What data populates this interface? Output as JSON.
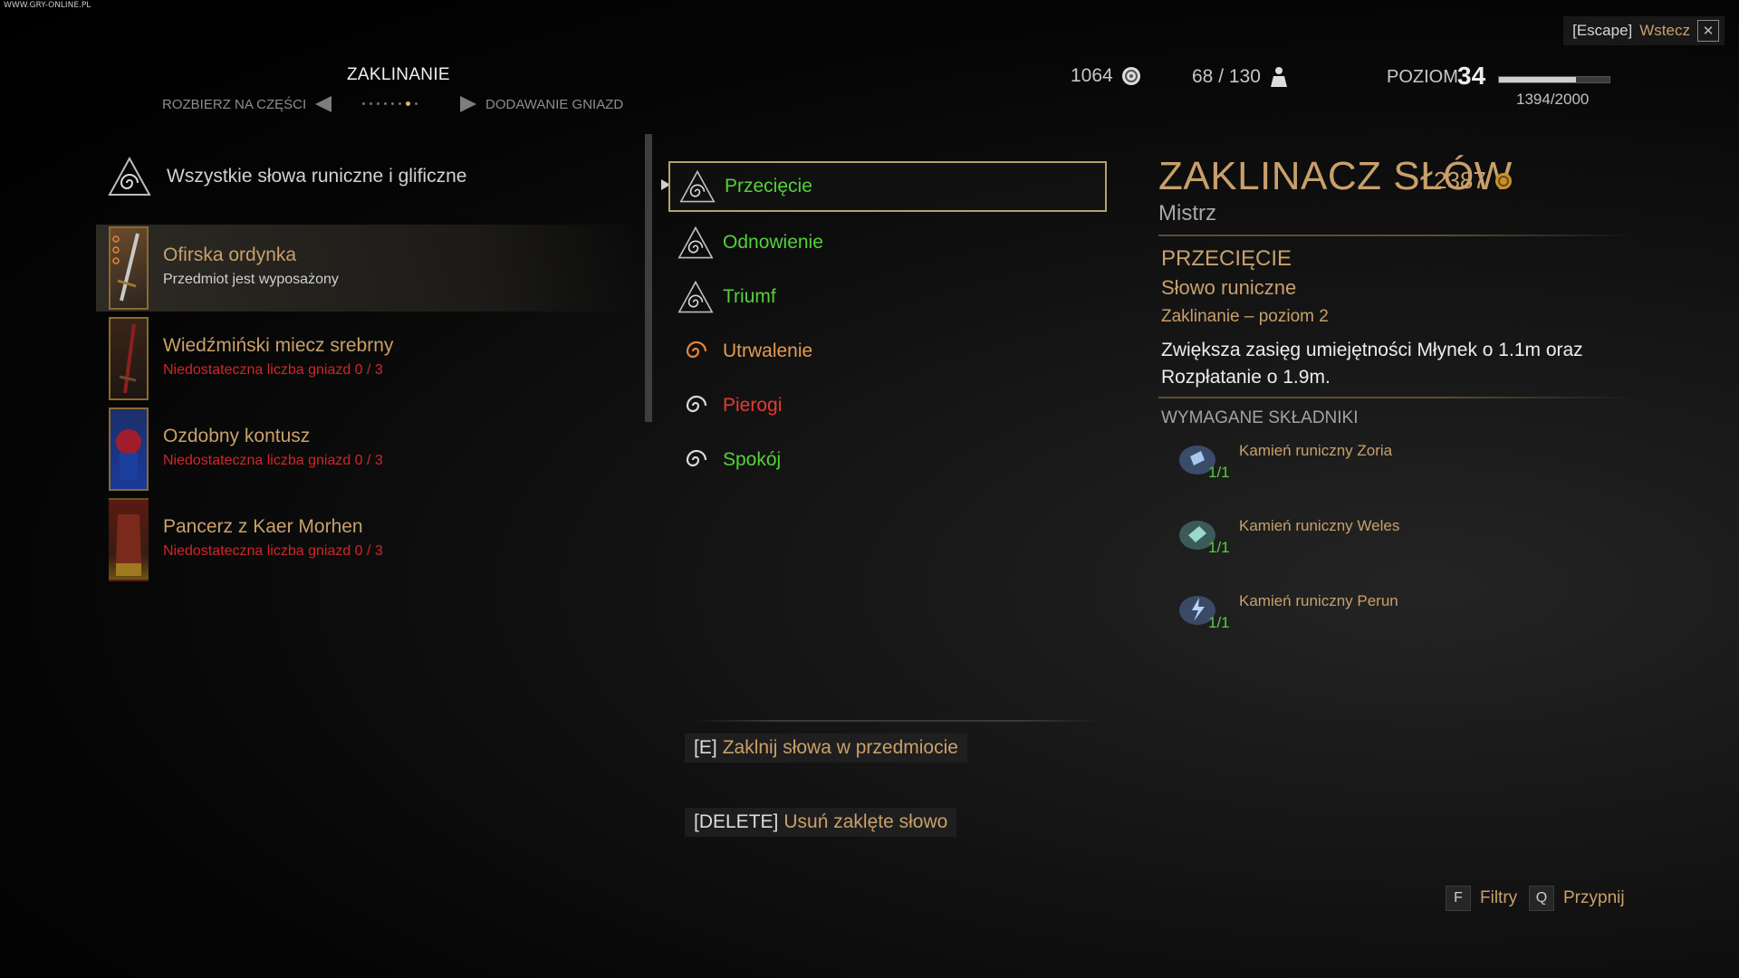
{
  "watermark": "WWW.GRY-ONLINE.PL",
  "escape": {
    "key": "[Escape]",
    "label": "Wstecz"
  },
  "header": {
    "title": "ZAKLINANIE",
    "prev_tab": "ROZBIERZ NA CZĘŚCI",
    "next_tab": "DODAWANIE GNIAZD"
  },
  "stats": {
    "crowns": "1064",
    "weight": "68 / 130",
    "level_label": "POZIOM",
    "level": "34",
    "xp_text": "1394/2000",
    "xp_progress": 0.697
  },
  "items_header": "Wszystkie słowa runiczne i glificzne",
  "items": [
    {
      "name": "Ofirska ordynka",
      "status": "Przedmiot jest wyposażony",
      "status_type": "ok",
      "icon": "sword-icon"
    },
    {
      "name": "Wiedźmiński miecz srebrny",
      "status": "Niedostateczna liczba gniazd 0 / 3",
      "status_type": "bad",
      "icon": "silver-sword-icon"
    },
    {
      "name": "Ozdobny kontusz",
      "status": "Niedostateczna liczba gniazd 0 / 3",
      "status_type": "bad",
      "icon": "coat-icon"
    },
    {
      "name": "Pancerz z Kaer Morhen",
      "status": "Niedostateczna liczba gniazd 0 / 3",
      "status_type": "bad",
      "icon": "armor-icon"
    }
  ],
  "runewords": [
    {
      "label": "Przecięcie",
      "color": "#54d13a",
      "icon": "runeword-icon"
    },
    {
      "label": "Odnowienie",
      "color": "#54d13a",
      "icon": "runeword-icon"
    },
    {
      "label": "Triumf",
      "color": "#54d13a",
      "icon": "runeword-icon"
    },
    {
      "label": "Utrwalenie",
      "color": "#e59a55",
      "icon": "glyphword-icon"
    },
    {
      "label": "Pierogi",
      "color": "#e53a33",
      "icon": "glyphword-icon"
    },
    {
      "label": "Spokój",
      "color": "#54d13a",
      "icon": "glyphword-icon"
    }
  ],
  "actions": {
    "enchant_key": "[E]",
    "enchant_label": "Zaklnij słowa w przedmiocie",
    "remove_key": "[DELETE]",
    "remove_label": "Usuń zaklęte słowo"
  },
  "detail": {
    "vendor": "ZAKLINACZ SŁÓW",
    "price": "2387",
    "vendor_rank": "Mistrz",
    "name": "PRZECIĘCIE",
    "type": "Słowo runiczne",
    "tier": "Zaklinanie – poziom 2",
    "description": "Zwiększa zasięg umiejętności Młynek o 1.1m oraz Rozpłatanie o 1.9m.",
    "required_label": "WYMAGANE SKŁADNIKI",
    "ingredients": [
      {
        "name": "Kamień runiczny Zoria",
        "count": "1/1",
        "icon": "runestone-zoria-icon"
      },
      {
        "name": "Kamień runiczny Weles",
        "count": "1/1",
        "icon": "runestone-weles-icon"
      },
      {
        "name": "Kamień runiczny Perun",
        "count": "1/1",
        "icon": "runestone-perun-icon"
      }
    ]
  },
  "hints": {
    "filters_key": "F",
    "filters_label": "Filtry",
    "pin_key": "Q",
    "pin_label": "Przypnij"
  },
  "colors": {
    "accent": "#c9a06a",
    "ok": "#54d13a",
    "bad": "#d0262a"
  }
}
